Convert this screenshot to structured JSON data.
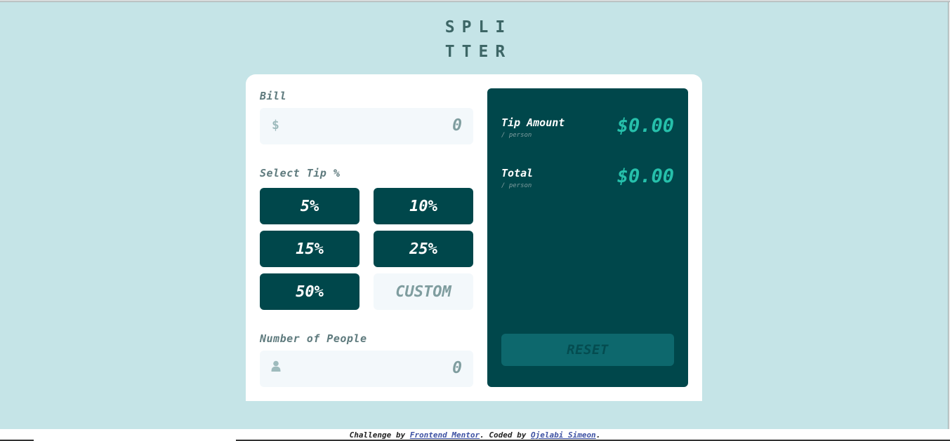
{
  "logo": {
    "line1": "SPLI",
    "line2": "TTER"
  },
  "bill": {
    "label": "Bill",
    "currency_icon": "$",
    "value": "0"
  },
  "tip": {
    "label": "Select Tip %",
    "options": [
      "5%",
      "10%",
      "15%",
      "25%",
      "50%"
    ],
    "custom_placeholder": "CUSTOM"
  },
  "people": {
    "label": "Number of People",
    "value": "0"
  },
  "results": {
    "tip_amount_label": "Tip Amount",
    "tip_amount_sub": "/ person",
    "tip_amount_value": "$0.00",
    "total_label": "Total",
    "total_sub": "/ person",
    "total_value": "$0.00",
    "reset_label": "RESET"
  },
  "footer": {
    "prefix": "Challenge by ",
    "link1": "Frontend Mentor",
    "middle": ". Coded by ",
    "link2": "Ojelabi Simeon",
    "suffix": "."
  },
  "colors": {
    "background": "#c5e4e7",
    "dark_cyan": "#00474b",
    "accent": "#26c0ab",
    "reset_bg": "#0d686d"
  }
}
